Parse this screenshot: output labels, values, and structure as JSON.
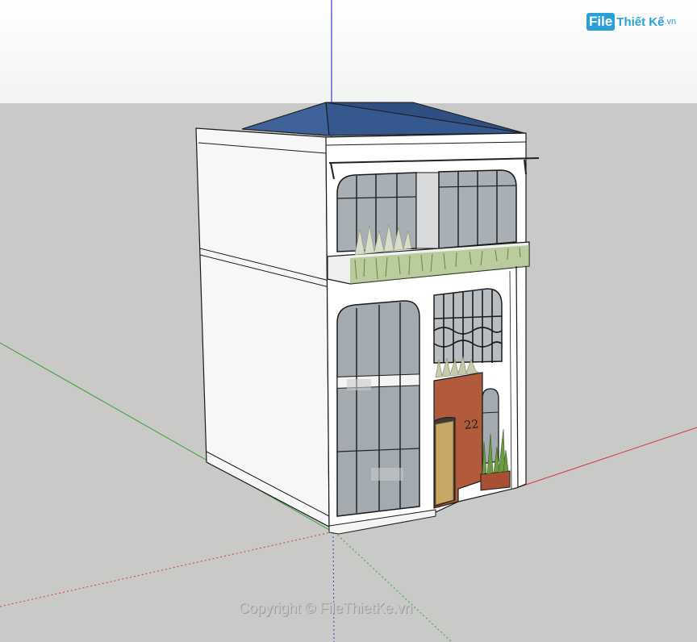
{
  "watermark": {
    "logo_file": "File",
    "logo_rest": "Thiết Kế",
    "logo_domain": ".vn",
    "copyright": "Copyright © FileThietKe.vn"
  },
  "house": {
    "house_number": "22"
  },
  "colors": {
    "sky": "#ffffff",
    "ground": "#c9c9c7",
    "roof": "#3a5a8c",
    "wall": "#ffffff",
    "glass": "#9aa3a8",
    "brick": "#b85a3e",
    "door": "#c9a766",
    "plant": "#7aa64a",
    "axis_red": "#d43a3a",
    "axis_green": "#3aa03a",
    "axis_blue": "#3a3ad4"
  }
}
